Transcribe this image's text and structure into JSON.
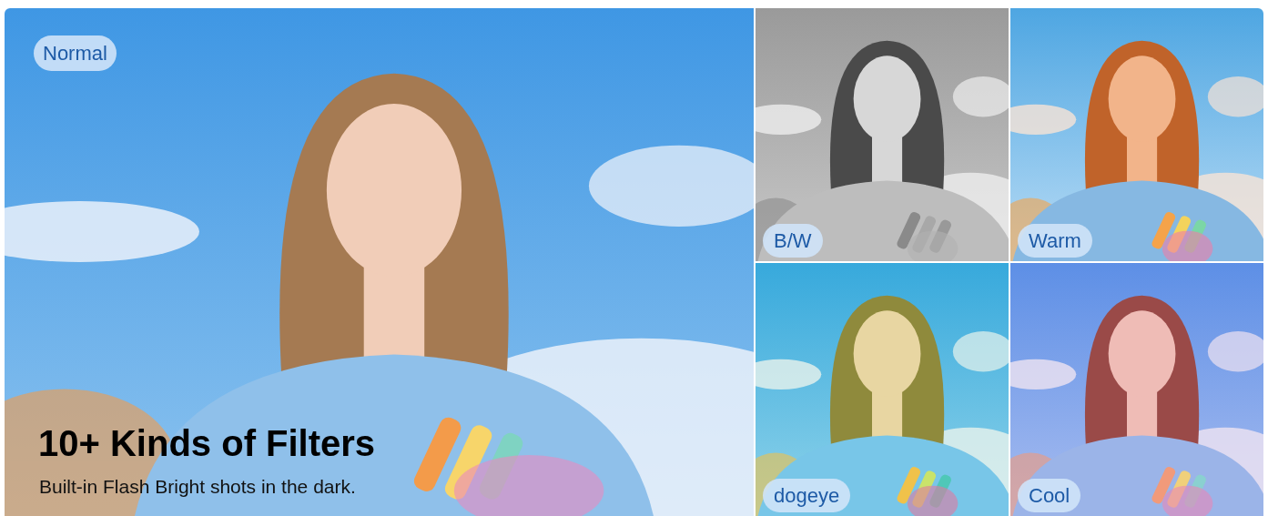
{
  "main": {
    "label": "Normal",
    "kind": "normal",
    "title": "10+ Kinds of Filters",
    "subtitle": "Built-in Flash Bright shots in the dark."
  },
  "tiles": [
    {
      "label": "B/W",
      "kind": "bw"
    },
    {
      "label": "Warm",
      "kind": "warm"
    },
    {
      "label": "dogeye",
      "kind": "green"
    },
    {
      "label": "Cool",
      "kind": "cool"
    }
  ]
}
